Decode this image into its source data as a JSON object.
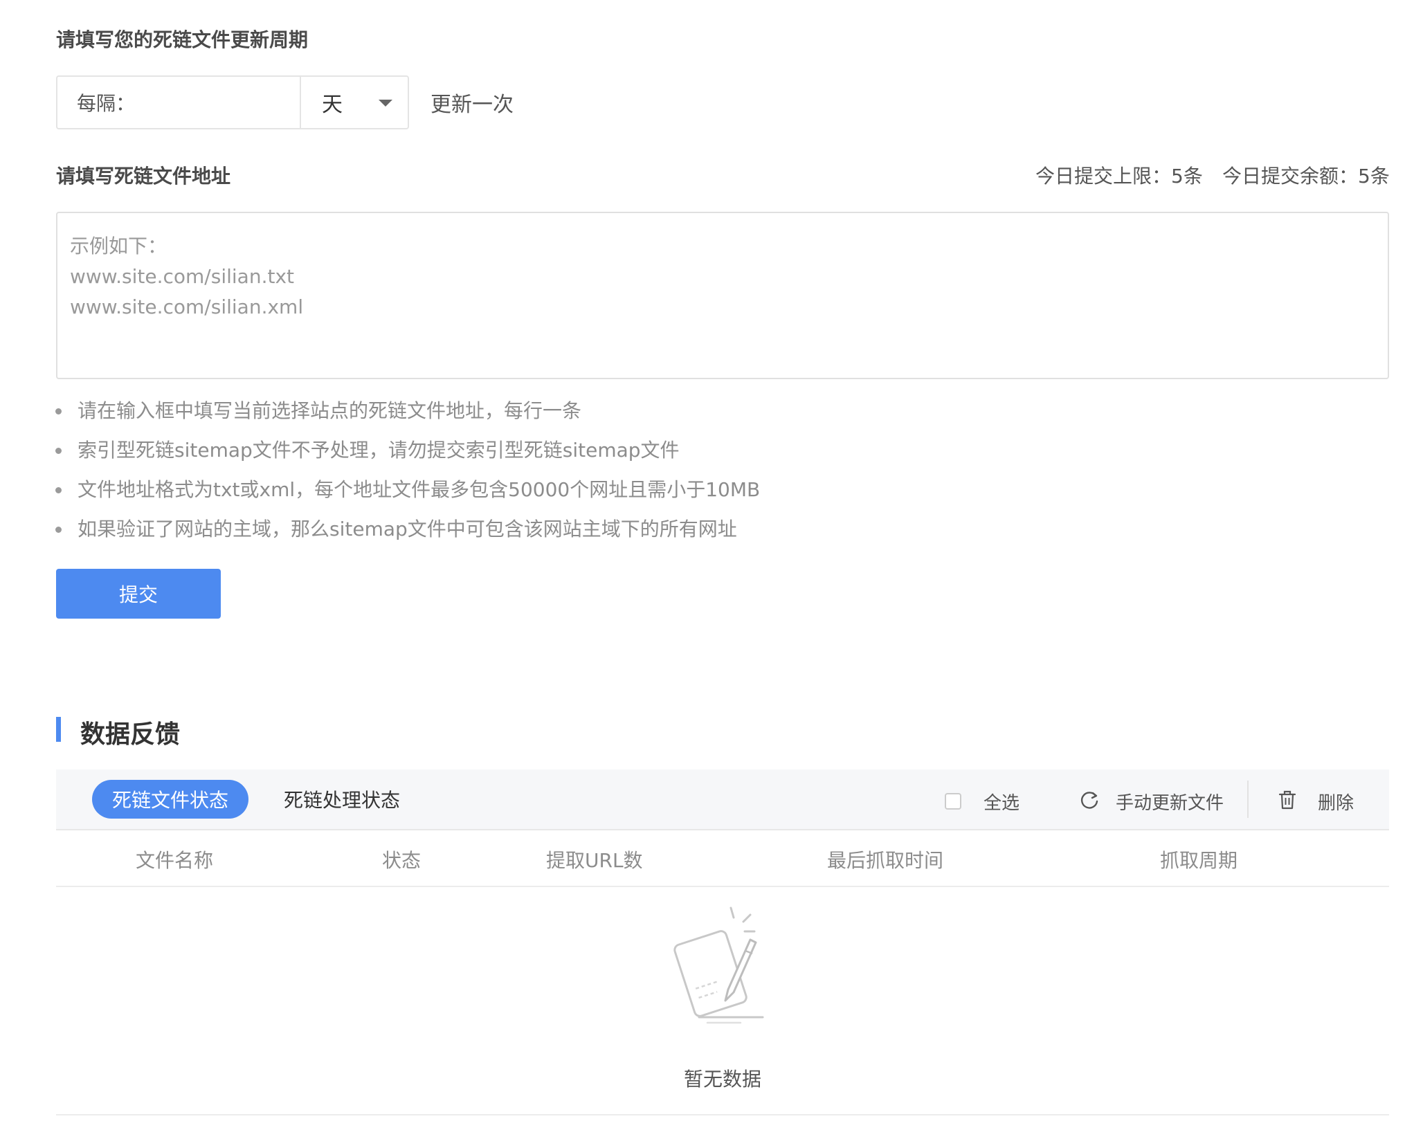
{
  "update_cycle": {
    "title": "请填写您的死链文件更新周期",
    "interval_label": "每隔：",
    "unit_value": "天",
    "suffix_text": "更新一次"
  },
  "file_address": {
    "title": "请填写死链文件地址",
    "daily_limit": "今日提交上限：5条",
    "daily_remaining": "今日提交余额：5条",
    "placeholder_lines": [
      "示例如下：",
      "www.site.com/silian.txt",
      "www.site.com/silian.xml"
    ]
  },
  "tips": [
    "请在输入框中填写当前选择站点的死链文件地址，每行一条",
    "索引型死链sitemap文件不予处理，请勿提交索引型死链sitemap文件",
    "文件地址格式为txt或xml，每个地址文件最多包含50000个网址且需小于10MB",
    "如果验证了网站的主域，那么sitemap文件中可包含该网站主域下的所有网址"
  ],
  "submit_label": "提交",
  "feedback": {
    "title": "数据反馈",
    "tabs": [
      "死链文件状态",
      "死链处理状态"
    ],
    "active_tab": 0,
    "select_all_label": "全选",
    "update_label": "手动更新文件",
    "delete_label": "删除",
    "columns": [
      "文件名称",
      "状态",
      "提取URL数",
      "最后抓取时间",
      "抓取周期"
    ],
    "empty_text": "暂无数据"
  },
  "colors": {
    "accent": "#4d8af0",
    "toolbar_bg": "#f6f7f9"
  },
  "icons": {
    "dropdown": "caret-down-icon",
    "refresh": "refresh-icon",
    "delete": "trash-icon",
    "empty": "empty-notepad-icon"
  }
}
